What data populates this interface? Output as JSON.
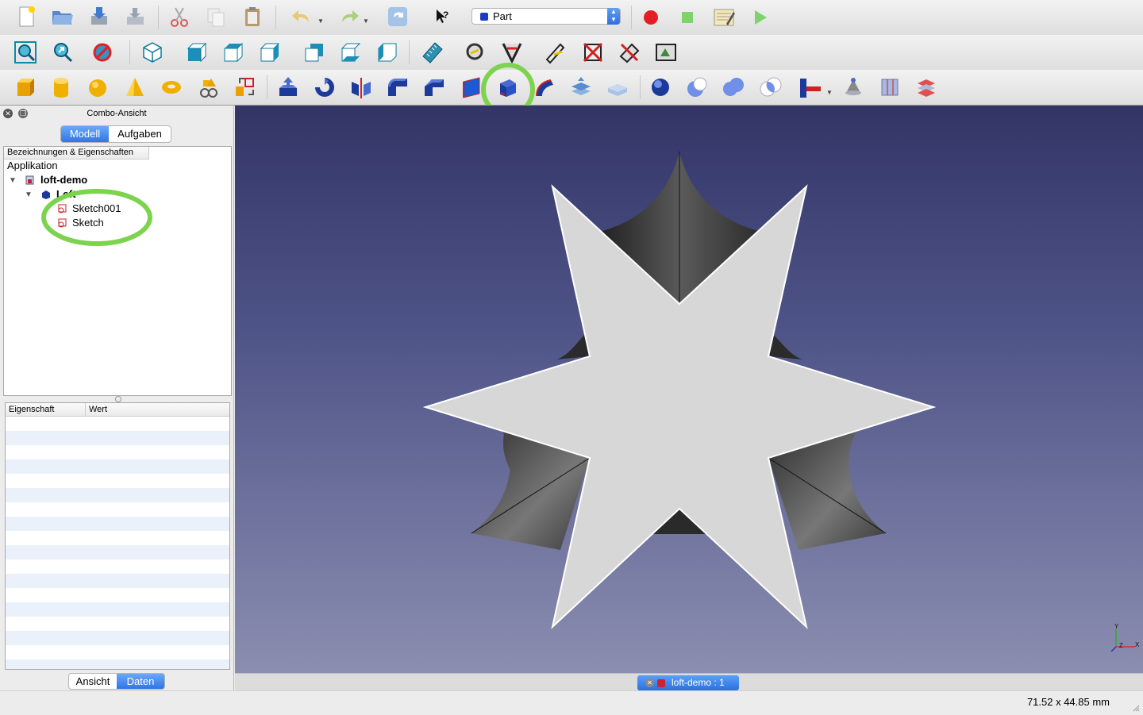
{
  "toolbar": {
    "workbench_selector": {
      "value": "Part"
    }
  },
  "combo_view": {
    "title": "Combo-Ansicht",
    "tabs_top": [
      {
        "label": "Modell",
        "active": true
      },
      {
        "label": "Aufgaben",
        "active": false
      }
    ],
    "tree": {
      "header": "Bezeichnungen & Eigenschaften",
      "application_label": "Applikation",
      "document": "loft-demo",
      "feature": "Loft",
      "children": [
        "Sketch001",
        "Sketch"
      ]
    },
    "properties": {
      "col_property": "Eigenschaft",
      "col_value": "Wert"
    },
    "tabs_bottom": [
      {
        "label": "Ansicht",
        "active": false
      },
      {
        "label": "Daten",
        "active": true
      }
    ]
  },
  "document_tab": {
    "label": "loft-demo : 1"
  },
  "status_bar": {
    "dimensions": "71.52 x 44.85 mm"
  },
  "axis_indicator": {
    "x": "X",
    "y": "Y",
    "z": "Z"
  },
  "colors": {
    "viewport_top": "#333566",
    "viewport_bottom": "#8b8eb0",
    "highlight_ring": "#7dd34e",
    "active_tab": "#2f76e6",
    "shape_face": "#d7d7d7"
  }
}
